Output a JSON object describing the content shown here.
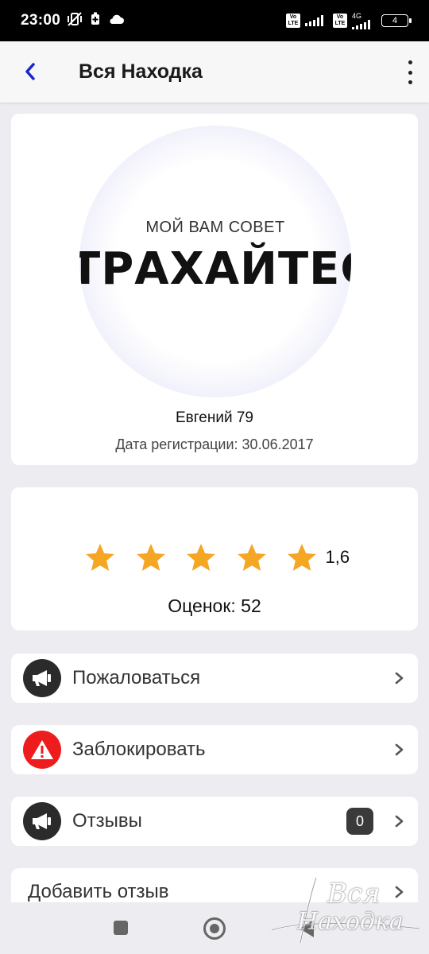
{
  "status_bar": {
    "time": "23:00",
    "sim1_tag": "Vo LTE",
    "sim2_tag": "Vo LTE",
    "network": "4G",
    "battery": "4"
  },
  "app_bar": {
    "back_icon": "chevron-left-icon",
    "title": "Вся Находка",
    "menu_icon": "more-vertical-icon"
  },
  "profile": {
    "avatar_text_small": "МОЙ ВАМ СОВЕТ",
    "avatar_text_big": "ТРАХАЙТЕСЬ",
    "name": "Евгений 79",
    "registration": "Дата регистрации: 30.06.2017"
  },
  "rating": {
    "stars_total": 5,
    "star_color": "#f5a623",
    "score": "1,6",
    "votes": "Оценок: 52"
  },
  "actions": [
    {
      "label": "Пожаловаться",
      "icon": "megaphone-icon",
      "icon_bg": "#2b2b2b"
    },
    {
      "label": "Заблокировать",
      "icon": "warning-icon",
      "icon_bg": "#ee1c1c"
    },
    {
      "label": "Отзывы",
      "icon": "megaphone-icon",
      "icon_bg": "#2b2b2b",
      "badge": "0"
    },
    {
      "label": "Добавить отзыв"
    }
  ],
  "watermark": {
    "line1": "Вся",
    "line2": "Находка"
  }
}
